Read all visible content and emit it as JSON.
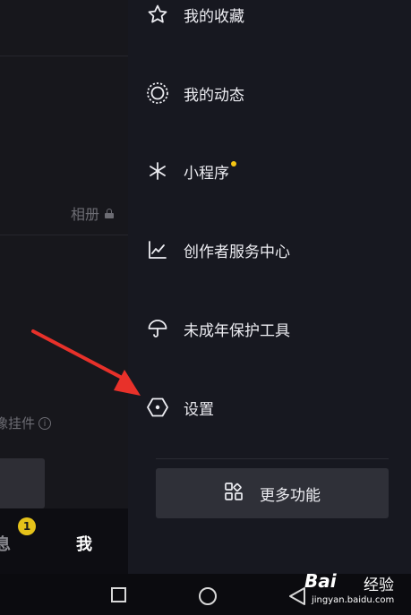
{
  "left_page": {
    "album_label": "相册",
    "widget_label": "像挂件",
    "tabs": {
      "messages_label": "息",
      "messages_badge": "1",
      "me_label": "我"
    }
  },
  "drawer": {
    "items": [
      {
        "label": "我的收藏",
        "icon": "star-icon"
      },
      {
        "label": "我的动态",
        "icon": "activity-circle-icon"
      },
      {
        "label": "小程序",
        "icon": "mini-program-icon",
        "has_dot": true
      },
      {
        "label": "创作者服务中心",
        "icon": "chart-line-icon"
      },
      {
        "label": "未成年保护工具",
        "icon": "umbrella-icon"
      },
      {
        "label": "设置",
        "icon": "hexagon-settings-icon"
      }
    ],
    "more_button": {
      "label": "更多功能",
      "icon": "grid-apps-icon"
    }
  },
  "watermark": {
    "brand": "Bai",
    "brand_cn": "经验",
    "url": "jingyan.baidu.com"
  },
  "colors": {
    "drawer_bg": "#171820",
    "accent_dot": "#f6c613",
    "arrow": "#e8312a",
    "badge": "#e5c21a"
  }
}
